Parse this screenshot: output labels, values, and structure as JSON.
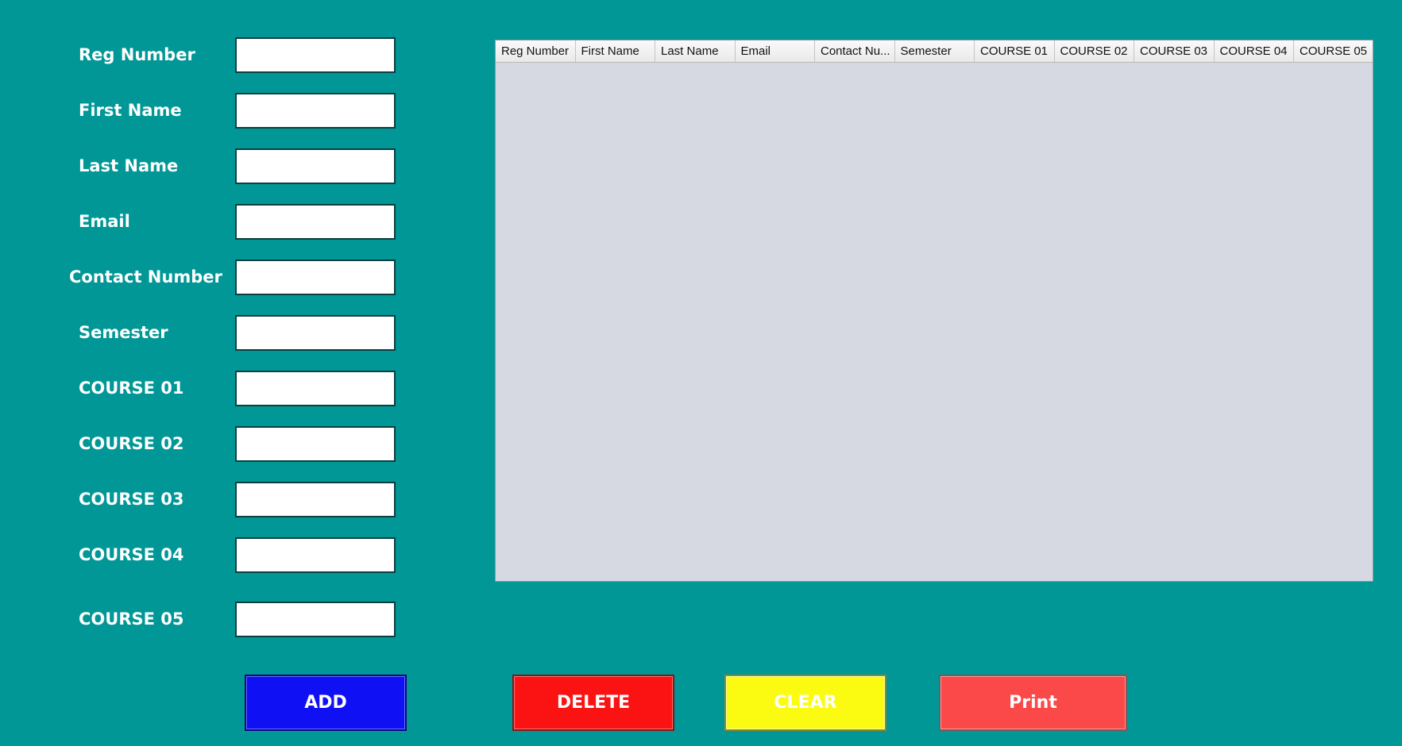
{
  "form": {
    "fields": [
      {
        "label": "Reg Number",
        "value": ""
      },
      {
        "label": "First Name",
        "value": ""
      },
      {
        "label": "Last Name",
        "value": ""
      },
      {
        "label": "Email",
        "value": ""
      },
      {
        "label": "Contact Number",
        "value": ""
      },
      {
        "label": "Semester",
        "value": ""
      },
      {
        "label": "COURSE 01",
        "value": ""
      },
      {
        "label": "COURSE 02",
        "value": ""
      },
      {
        "label": "COURSE 03",
        "value": ""
      },
      {
        "label": "COURSE 04",
        "value": ""
      },
      {
        "label": "COURSE 05",
        "value": ""
      }
    ]
  },
  "table": {
    "columns": [
      "Reg Number",
      "First Name",
      "Last Name",
      "Email",
      "Contact Nu...",
      "Semester",
      "COURSE 01",
      "COURSE 02",
      "COURSE 03",
      "COURSE 04",
      "COURSE 05"
    ],
    "rows": []
  },
  "buttons": {
    "add": {
      "label": "ADD",
      "color": "#1010f5"
    },
    "delete": {
      "label": "DELETE",
      "color": "#fb1212"
    },
    "clear": {
      "label": "CLEAR",
      "color": "#fbfb12"
    },
    "print": {
      "label": "Print",
      "color": "#fb4848"
    }
  },
  "colors": {
    "background": "#019797",
    "table_body": "#d6d9e1"
  }
}
